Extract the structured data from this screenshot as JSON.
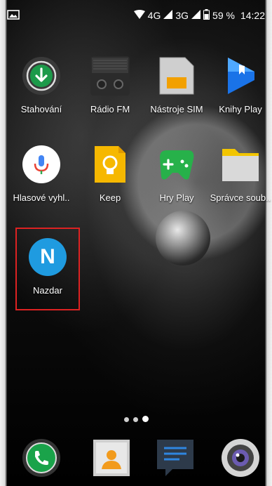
{
  "status_bar": {
    "network_4g": "4G",
    "network_3g": "3G",
    "battery_percent": "59 %",
    "time": "14:22"
  },
  "apps_row1": [
    {
      "label": "Stahování",
      "icon": "download-icon"
    },
    {
      "label": "Rádio FM",
      "icon": "radio-icon"
    },
    {
      "label": "Nástroje SIM",
      "icon": "sim-card-icon"
    },
    {
      "label": "Knihy Play",
      "icon": "play-books-icon"
    }
  ],
  "apps_row2": [
    {
      "label": "Hlasové vyhl..",
      "icon": "microphone-icon"
    },
    {
      "label": "Keep",
      "icon": "keep-bulb-icon"
    },
    {
      "label": "Hry Play",
      "icon": "play-games-icon"
    },
    {
      "label": "Správce soub..",
      "icon": "folder-icon"
    }
  ],
  "apps_row3": [
    {
      "label": "Nazdar",
      "icon": "nazdar-n-icon",
      "letter": "N"
    }
  ],
  "dock": [
    {
      "icon": "phone-icon"
    },
    {
      "icon": "contacts-icon"
    },
    {
      "icon": "messages-icon"
    },
    {
      "icon": "camera-icon"
    }
  ],
  "colors": {
    "selection": "#dd2222",
    "nazdar_blue": "#1f9be0",
    "keep_yellow": "#f6b800",
    "games_green": "#27b14a",
    "books_blue": "#1a73e8"
  }
}
